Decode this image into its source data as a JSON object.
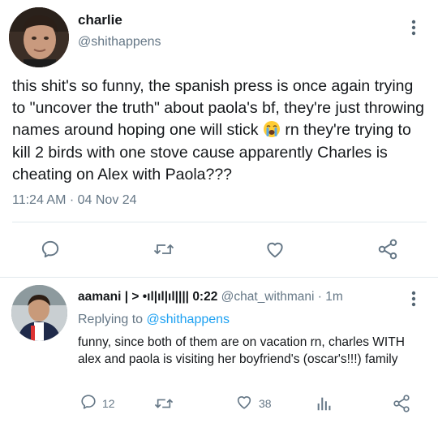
{
  "main_tweet": {
    "display_name": "charlie",
    "handle": "@shithappens",
    "text_before_emoji": "this shit's so funny, the spanish press is once again trying to \"uncover the truth\" about paola's bf, they're just throwing names around hoping one will stick",
    "emoji": "loudly-crying-face",
    "text_after_emoji": " rn they're trying to kill 2 birds with one stove cause apparently Charles is cheating on Alex with Paola???",
    "timestamp": "11:24 AM · 04 Nov 24",
    "actions": [
      "reply-icon",
      "retweet-icon",
      "like-icon",
      "share-icon"
    ]
  },
  "reply_tweet": {
    "display_name": "aamani | > •ıl|ıl|ıl|||| 0:22",
    "handle": "@chat_withmani",
    "time": "· 1m",
    "replying_prefix": "Replying to ",
    "replying_handle": "@shithappens",
    "text": "funny, since both of them are on vacation rn, charles WITH alex and paola is visiting her boyfriend's (oscar's!!!) family",
    "reply_count": "12",
    "like_count": "38"
  },
  "colors": {
    "text": "#14171a",
    "secondary": "#657786",
    "link": "#1da1f2",
    "divider": "#e1e8ed"
  }
}
